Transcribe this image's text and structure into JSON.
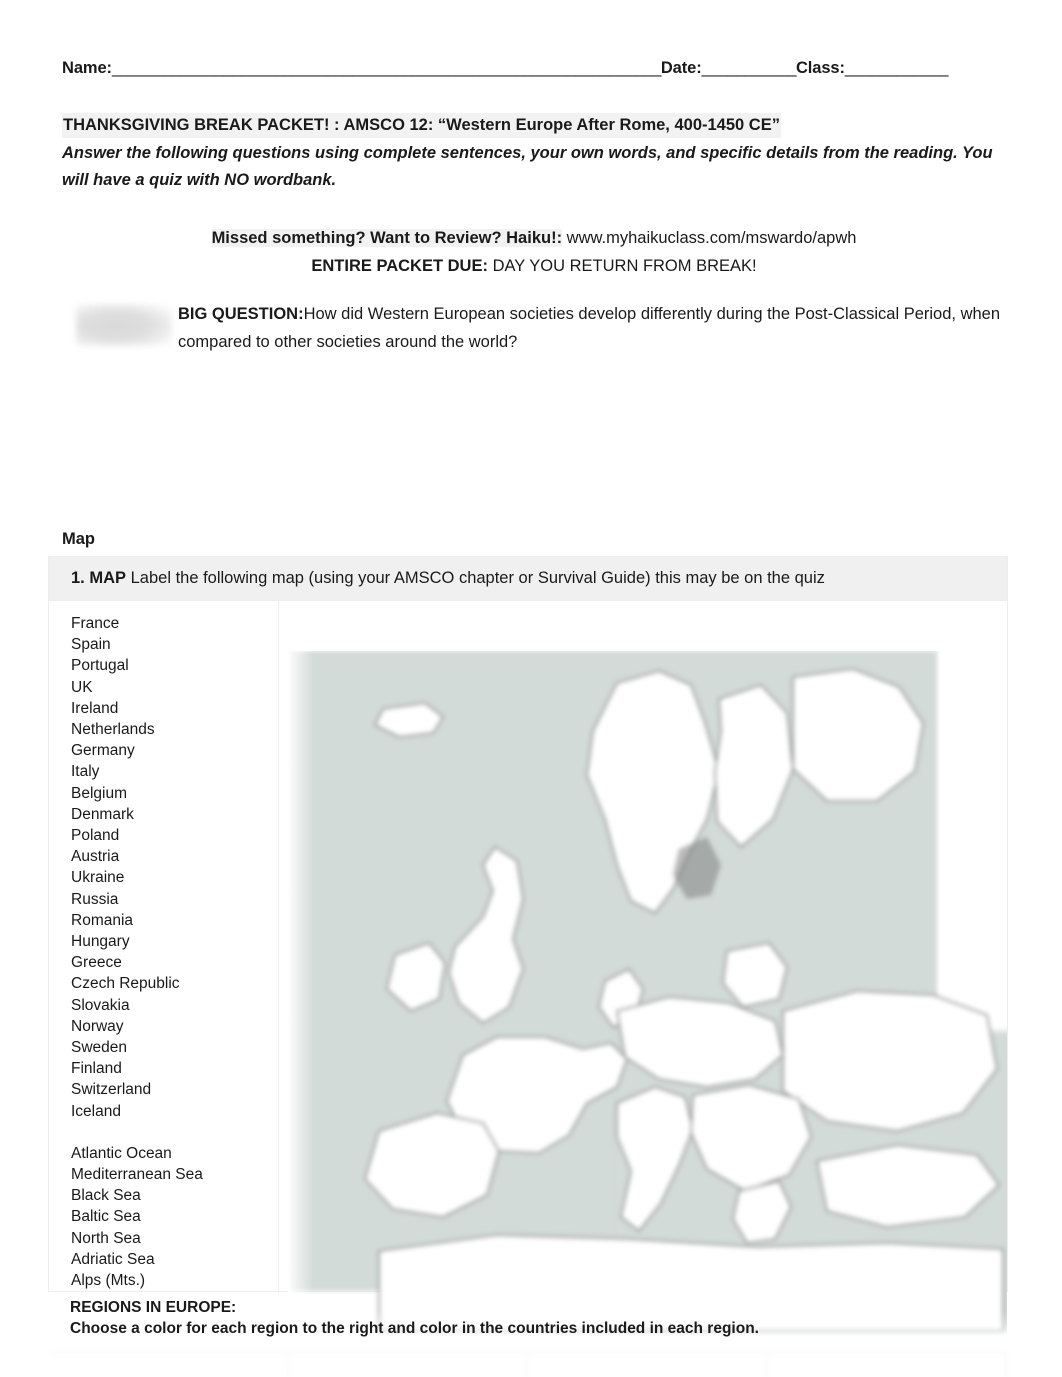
{
  "header": {
    "name_label": "Name:",
    "name_rule": "________________________________________________________________",
    "date_label": "Date:",
    "date_rule": "___________",
    "class_label": "Class:",
    "class_rule": "____________"
  },
  "title": {
    "packet_title": "THANKSGIVING BREAK PACKET! : AMSCO 12: “Western Europe After Rome, 400-1450 CE”",
    "instructions": "Answer the following questions using complete sentences, your own words, and specific details from the reading. You will have a quiz with NO wordbank."
  },
  "review": {
    "haiku_label": "Missed something? Want to Review? Haiku!:",
    "haiku_url": "www.myhaikuclass.com/mswardo/apwh",
    "due_label": "ENTIRE PACKET DUE:",
    "due_value": "DAY YOU RETURN FROM BREAK!"
  },
  "big_question": {
    "label": "BIG QUESTION:",
    "text": "How did Western European societies develop differently during the Post-Classical Period, when compared to other societies around the world?"
  },
  "map_section": {
    "heading": "Map",
    "question_number": "1. MAP",
    "question_text": "Label the following map (using your AMSCO chapter or Survival Guide) this may be on the quiz",
    "countries": [
      "France",
      "Spain",
      "Portugal",
      "UK",
      "Ireland",
      "Netherlands",
      "Germany",
      "Italy",
      "Belgium",
      "Denmark",
      "Poland",
      "Austria",
      "Ukraine",
      "Russia",
      "Romania",
      "Hungary",
      "Greece",
      "Czech Republic",
      "Slovakia",
      "Norway",
      "Sweden",
      "Finland",
      "Switzerland",
      "Iceland"
    ],
    "water_features": [
      "Atlantic Ocean",
      "Mediterranean Sea",
      "Black Sea",
      "Baltic Sea",
      "North Sea",
      "Adriatic Sea",
      "Alps (Mts.)"
    ],
    "map_image_name": "blurred-outline-map-of-europe"
  },
  "regions": {
    "heading": "REGIONS IN EUROPE:",
    "instruction": "Choose a color for each region to the right and color in the countries included in each region."
  },
  "bottom_partial_table": {
    "cells": [
      "",
      "",
      "",
      ""
    ]
  },
  "colors": {
    "page_background": "#ffffff",
    "text": "#1a1a1a",
    "highlight": "#f2f2f2",
    "table_header_fill": "#f0f0f0",
    "table_border": "#ededed",
    "map_sea": "#d3dbd8",
    "map_outline": "#808080"
  }
}
